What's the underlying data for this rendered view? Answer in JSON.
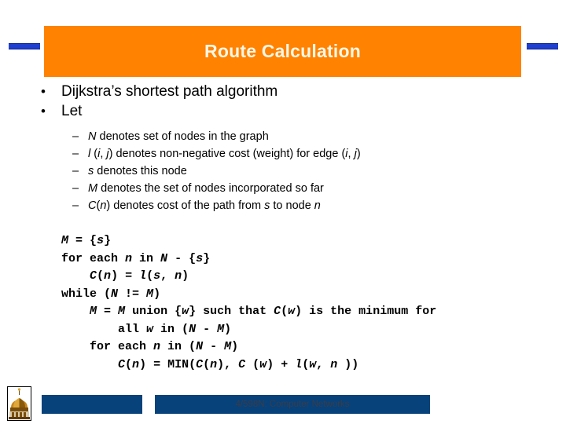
{
  "slide": {
    "title": "Route Calculation",
    "title_bg_color": "#FF8200",
    "title_text_color": "#FFF7E6",
    "accent_bar_color": "#1F3FD0"
  },
  "bullets": [
    {
      "marker": "•",
      "text": "Dijkstra’s shortest path algorithm"
    },
    {
      "marker": "•",
      "text": "Let"
    }
  ],
  "sub_bullets": [
    {
      "marker": "–",
      "segments": [
        {
          "text": "N",
          "italic": true
        },
        {
          "text": " denotes set of nodes in the graph",
          "italic": false
        }
      ]
    },
    {
      "marker": "–",
      "segments": [
        {
          "text": "l",
          "italic": true
        },
        {
          "text": " (",
          "italic": false
        },
        {
          "text": "i",
          "italic": true
        },
        {
          "text": ", ",
          "italic": false
        },
        {
          "text": "j",
          "italic": true
        },
        {
          "text": ") denotes non-negative cost (weight) for edge (",
          "italic": false
        },
        {
          "text": "i",
          "italic": true
        },
        {
          "text": ", ",
          "italic": false
        },
        {
          "text": "j",
          "italic": true
        },
        {
          "text": ")",
          "italic": false
        }
      ]
    },
    {
      "marker": "–",
      "segments": [
        {
          "text": "s",
          "italic": true
        },
        {
          "text": "  denotes this node",
          "italic": false
        }
      ]
    },
    {
      "marker": "–",
      "segments": [
        {
          "text": "M",
          "italic": true
        },
        {
          "text": " denotes the set of nodes incorporated so far",
          "italic": false
        }
      ]
    },
    {
      "marker": "–",
      "segments": [
        {
          "text": "C",
          "italic": true
        },
        {
          "text": "(",
          "italic": false
        },
        {
          "text": "n",
          "italic": true
        },
        {
          "text": ") denotes cost of the path from ",
          "italic": false
        },
        {
          "text": "s",
          "italic": true
        },
        {
          "text": " to node ",
          "italic": false
        },
        {
          "text": "n",
          "italic": true
        }
      ]
    }
  ],
  "code": {
    "plain_text": "M = {s}\nfor each n in N - {s}\n    C(n) = l(s, n)\nwhile (N != M)\n    M = M union {w} such that C(w) is the minimum for\n        all w in (N - M)\n    for each n in (N - M)\n        C(n) = MIN(C(n), C (w) + l(w, n ))",
    "lines": [
      {
        "segments": [
          {
            "text": "M",
            "italic": true
          },
          {
            "text": " = {",
            "italic": false
          },
          {
            "text": "s",
            "italic": true
          },
          {
            "text": "}",
            "italic": false
          }
        ]
      },
      {
        "segments": [
          {
            "text": "for each ",
            "italic": false
          },
          {
            "text": "n",
            "italic": true
          },
          {
            "text": " in ",
            "italic": false
          },
          {
            "text": "N",
            "italic": true
          },
          {
            "text": " - {",
            "italic": false
          },
          {
            "text": "s",
            "italic": true
          },
          {
            "text": "}",
            "italic": false
          }
        ]
      },
      {
        "segments": [
          {
            "text": "    ",
            "italic": false
          },
          {
            "text": "C",
            "italic": true
          },
          {
            "text": "(",
            "italic": false
          },
          {
            "text": "n",
            "italic": true
          },
          {
            "text": ") = ",
            "italic": false
          },
          {
            "text": "l",
            "italic": true
          },
          {
            "text": "(",
            "italic": false
          },
          {
            "text": "s",
            "italic": true
          },
          {
            "text": ", ",
            "italic": false
          },
          {
            "text": "n",
            "italic": true
          },
          {
            "text": ")",
            "italic": false
          }
        ]
      },
      {
        "segments": [
          {
            "text": "while (",
            "italic": false
          },
          {
            "text": "N",
            "italic": true
          },
          {
            "text": " != ",
            "italic": false
          },
          {
            "text": "M",
            "italic": true
          },
          {
            "text": ")",
            "italic": false
          }
        ]
      },
      {
        "segments": [
          {
            "text": "    ",
            "italic": false
          },
          {
            "text": "M",
            "italic": true
          },
          {
            "text": " = ",
            "italic": false
          },
          {
            "text": "M",
            "italic": true
          },
          {
            "text": " union {",
            "italic": false
          },
          {
            "text": "w",
            "italic": true
          },
          {
            "text": "} such that ",
            "italic": false
          },
          {
            "text": "C",
            "italic": true
          },
          {
            "text": "(",
            "italic": false
          },
          {
            "text": "w",
            "italic": true
          },
          {
            "text": ") is the minimum for",
            "italic": false
          }
        ]
      },
      {
        "segments": [
          {
            "text": "        all ",
            "italic": false
          },
          {
            "text": "w",
            "italic": true
          },
          {
            "text": " in (",
            "italic": false
          },
          {
            "text": "N",
            "italic": true
          },
          {
            "text": " - ",
            "italic": false
          },
          {
            "text": "M",
            "italic": true
          },
          {
            "text": ")",
            "italic": false
          }
        ]
      },
      {
        "segments": [
          {
            "text": "    for each ",
            "italic": false
          },
          {
            "text": "n",
            "italic": true
          },
          {
            "text": " in (",
            "italic": false
          },
          {
            "text": "N",
            "italic": true
          },
          {
            "text": " - ",
            "italic": false
          },
          {
            "text": "M",
            "italic": true
          },
          {
            "text": ")",
            "italic": false
          }
        ]
      },
      {
        "segments": [
          {
            "text": "        ",
            "italic": false
          },
          {
            "text": "C",
            "italic": true
          },
          {
            "text": "(",
            "italic": false
          },
          {
            "text": "n",
            "italic": true
          },
          {
            "text": ") = MIN(",
            "italic": false
          },
          {
            "text": "C",
            "italic": true
          },
          {
            "text": "(",
            "italic": false
          },
          {
            "text": "n",
            "italic": true
          },
          {
            "text": "), ",
            "italic": false
          },
          {
            "text": "C",
            "italic": true
          },
          {
            "text": " (",
            "italic": false
          },
          {
            "text": "w",
            "italic": true
          },
          {
            "text": ") + ",
            "italic": false
          },
          {
            "text": "l",
            "italic": true
          },
          {
            "text": "(",
            "italic": false
          },
          {
            "text": "w",
            "italic": true
          },
          {
            "text": ", ",
            "italic": false
          },
          {
            "text": "n",
            "italic": true
          },
          {
            "text": " ))",
            "italic": false
          }
        ]
      }
    ]
  },
  "footer": {
    "text": "4/598N: Computer Networks",
    "bar_color": "#07427B",
    "text_color": "#3C3C46",
    "logo_icon": "golden-dome-building-icon"
  }
}
